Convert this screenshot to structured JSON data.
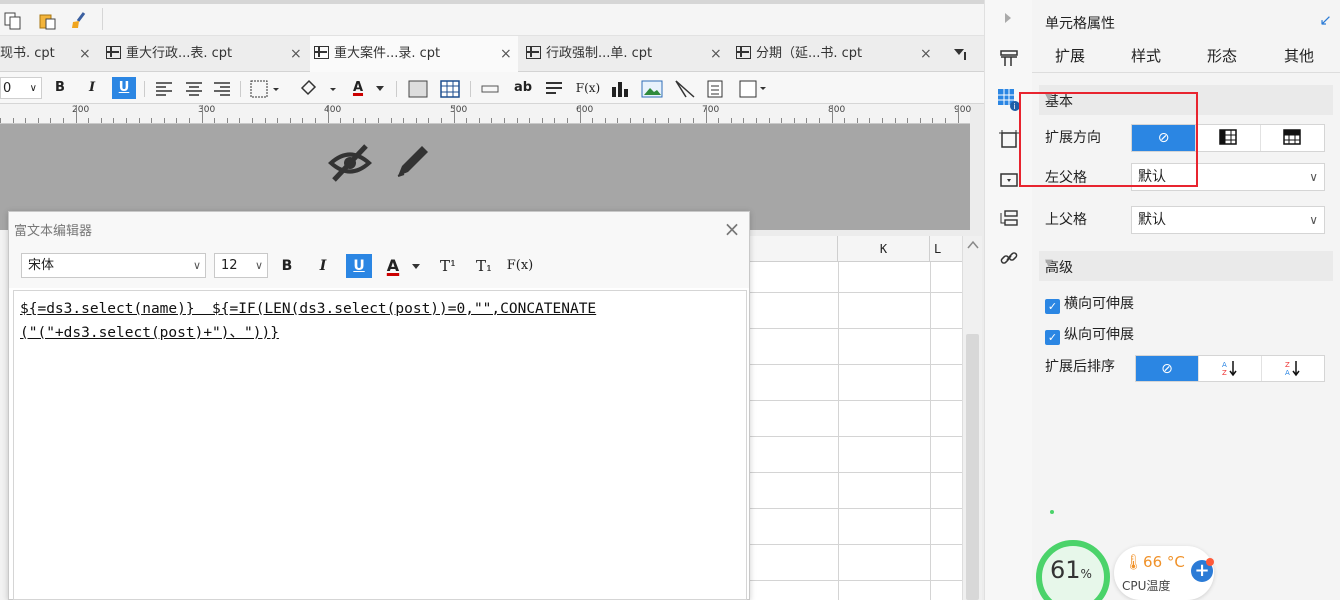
{
  "tabs": [
    {
      "label": "现书. cpt",
      "close": "×"
    },
    {
      "label": "重大行政...表. cpt",
      "close": "×"
    },
    {
      "label": "重大案件...录. cpt",
      "close": "×"
    },
    {
      "label": "行政强制...单. cpt",
      "close": "×"
    },
    {
      "label": "分期（延...书. cpt",
      "close": "×"
    }
  ],
  "format_toolbar": {
    "font_size": "0",
    "bold": "B",
    "italic": "I",
    "underline": "U",
    "font_color": "A",
    "text_button": "ab",
    "formula_button": "F(x)"
  },
  "ruler": {
    "marks": [
      "200",
      "300",
      "400",
      "500",
      "600",
      "700",
      "800",
      "900"
    ]
  },
  "sheet": {
    "columns": [
      "K",
      "L"
    ]
  },
  "rich_text_editor": {
    "title": "富文本编辑器",
    "close": "×",
    "font_family": "宋体",
    "font_size": "12",
    "bold": "B",
    "italic": "I",
    "underline": "U",
    "font_color": "A",
    "superscript": "T¹",
    "subscript": "T₁",
    "formula": "F(x)",
    "content_line1": "${=ds3.select(name)}  ${=IF(LEN(ds3.select(post))=0,\"\",CONCATENATE",
    "content_line2": "(\"(\"+ds3.select(post)+\")、\"))}"
  },
  "cell_properties": {
    "title": "单元格属性",
    "tabs": [
      "扩展",
      "样式",
      "形态",
      "其他"
    ],
    "basic_section": "基本",
    "expand_direction_label": "扩展方向",
    "left_parent_label": "左父格",
    "left_parent_value": "默认",
    "top_parent_label": "上父格",
    "top_parent_value": "默认",
    "advanced_section": "高级",
    "horizontal_expand": "横向可伸展",
    "vertical_expand": "纵向可伸展",
    "sort_after_expand": "扩展后排序",
    "accent_color": "#2b86e3"
  },
  "cpu_widget": {
    "percent": "61",
    "percent_unit": "%",
    "temperature": "66 °C",
    "label": "CPU温度",
    "plus": "+"
  }
}
